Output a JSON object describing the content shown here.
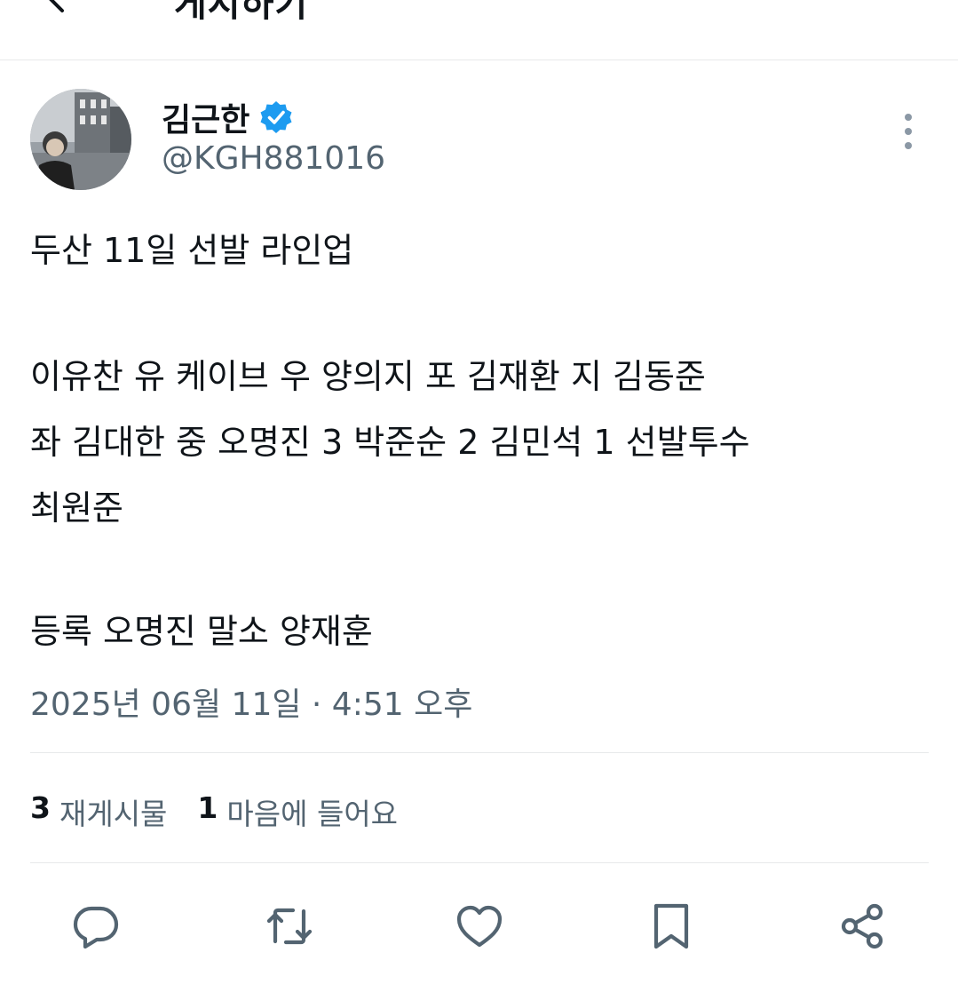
{
  "topbar": {
    "title": "게시하기"
  },
  "author": {
    "display_name": "김근한",
    "handle": "@KGH881016"
  },
  "tweet": {
    "lines": [
      "두산 11일 선발 라인업",
      "이유찬 유 케이브 우 양의지 포 김재환 지 김동준",
      "좌 김대한 중 오명진 3 박준순 2 김민석 1 선발투수",
      "최원준",
      "등록 오명진 말소 양재훈"
    ],
    "timestamp": "2025년 06월 11일 · 4:51 오후"
  },
  "stats": {
    "retweets_count": "3",
    "retweets_label": "재게시물",
    "likes_count": "1",
    "likes_label": "마음에 들어요"
  },
  "colors": {
    "text_primary": "#0f1419",
    "text_secondary": "#536471",
    "verified_blue": "#1d9bf0",
    "divider": "#e7e9ea"
  },
  "icons": [
    "back-arrow-icon",
    "verified-badge-icon",
    "more-options-icon",
    "reply-icon",
    "retweet-icon",
    "like-icon",
    "bookmark-icon",
    "share-icon"
  ]
}
